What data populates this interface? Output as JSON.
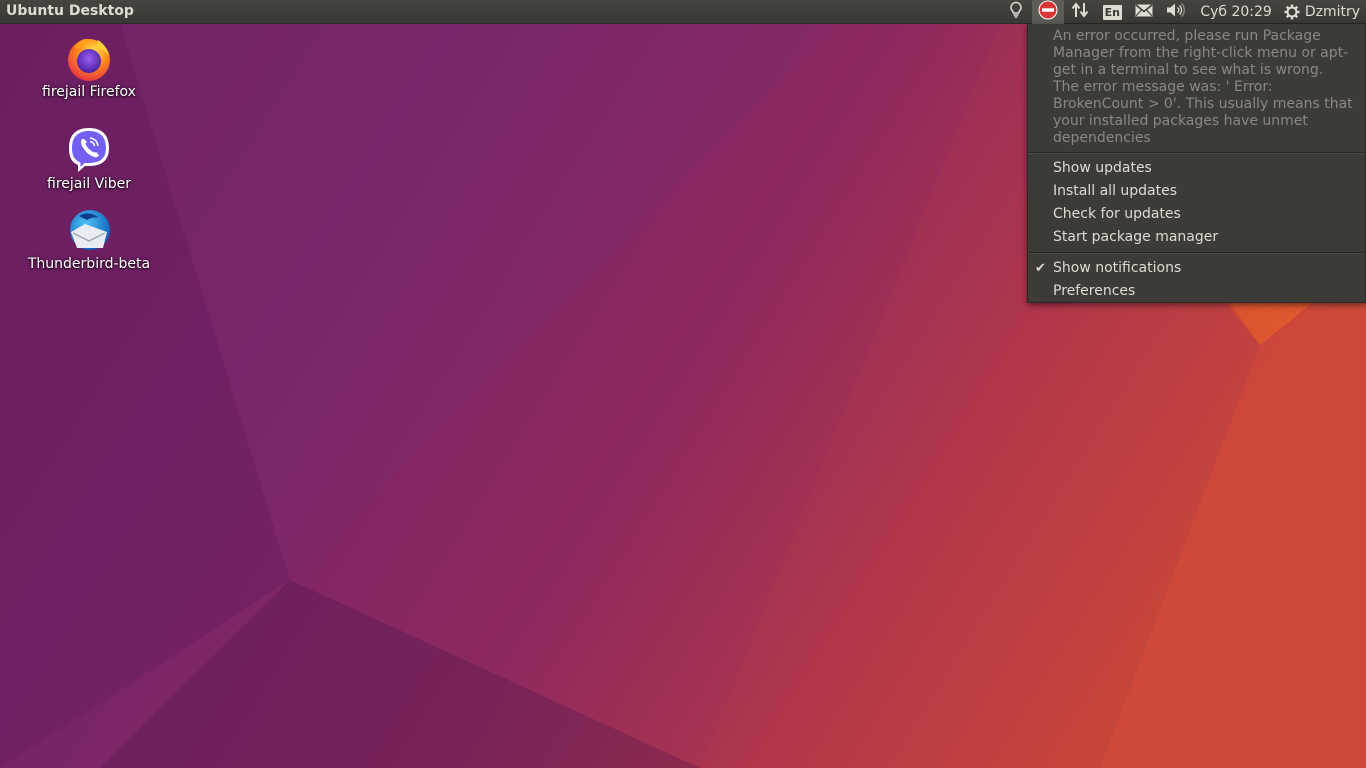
{
  "panel": {
    "title": "Ubuntu Desktop",
    "language_badge": "En",
    "clock": "Суб 20:29",
    "user": "Dzmitry",
    "icons": [
      "lightbulb-icon",
      "no-entry-icon",
      "network-arrows-icon",
      "keyboard-language-icon",
      "mail-icon",
      "volume-icon",
      "gear-icon"
    ]
  },
  "desktop": {
    "icons": [
      {
        "label": "firejail Firefox",
        "icon": "firefox-icon"
      },
      {
        "label": "firejail Viber",
        "icon": "viber-icon"
      },
      {
        "label": "Thunderbird-beta",
        "icon": "thunderbird-icon"
      }
    ]
  },
  "menu": {
    "error_message": "An error occurred, please run Package Manager from the right-click menu or apt-get in a terminal to see what is wrong. The error message was: ' Error: BrokenCount > 0'. This usually means that your installed packages have unmet dependencies",
    "items": [
      {
        "label": "Show updates"
      },
      {
        "label": "Install all updates"
      },
      {
        "label": "Check for updates"
      },
      {
        "label": "Start package manager"
      }
    ],
    "toggle_items": [
      {
        "label": "Show notifications",
        "checked": true
      },
      {
        "label": "Preferences",
        "checked": false
      }
    ],
    "check_glyph": "✔"
  },
  "colors": {
    "panel_bg": "#3c3b37",
    "panel_text": "#dfdbd2",
    "menu_bg": "#3c3b37",
    "menu_disabled_text": "#8a8881",
    "wallpaper_purple": "#77216f",
    "wallpaper_orange": "#e95420"
  }
}
